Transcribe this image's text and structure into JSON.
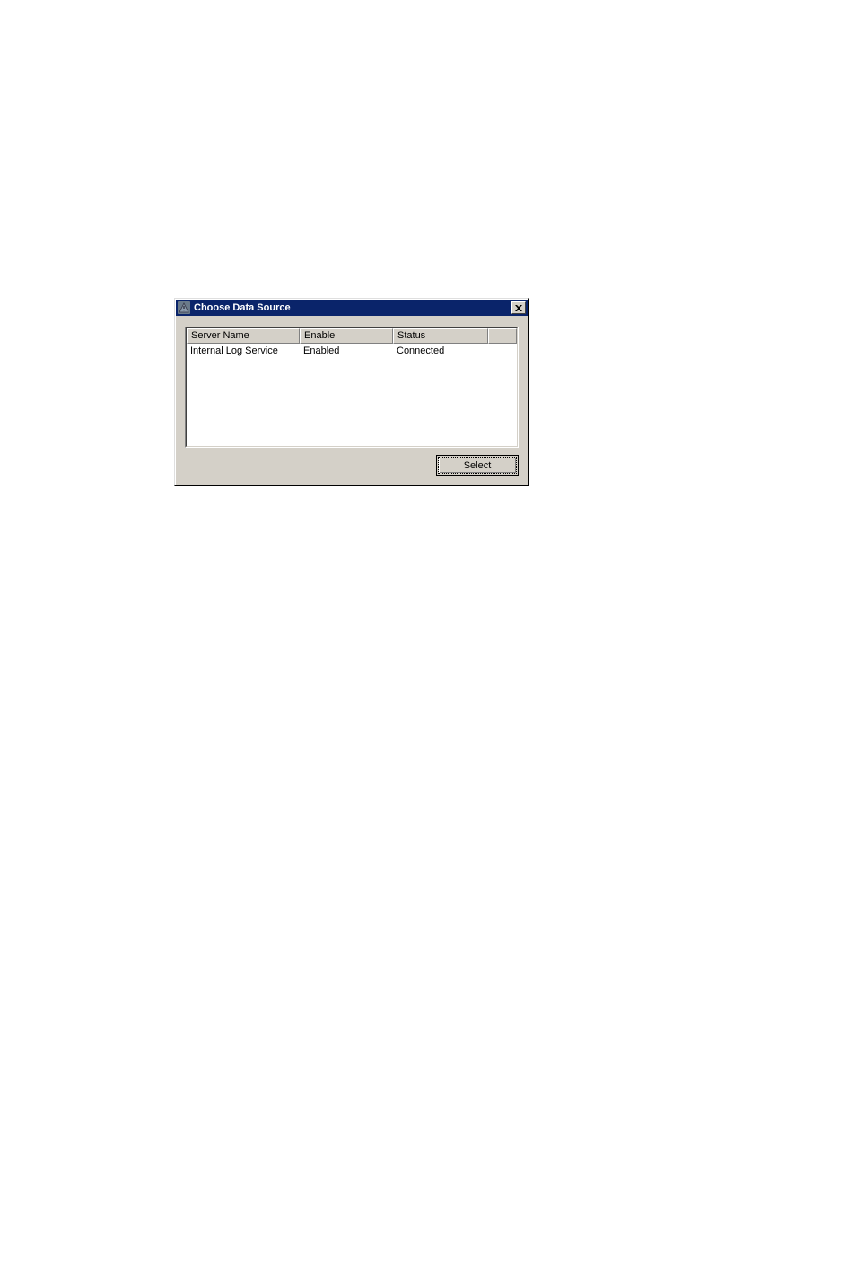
{
  "dialog": {
    "title": "Choose Data Source",
    "close_glyph": "✕",
    "columns": [
      "Server Name",
      "Enable",
      "Status",
      ""
    ],
    "rows": [
      {
        "server": "Internal Log Service",
        "enable": "Enabled",
        "status": "Connected"
      }
    ],
    "buttons": {
      "select": "Select"
    }
  }
}
